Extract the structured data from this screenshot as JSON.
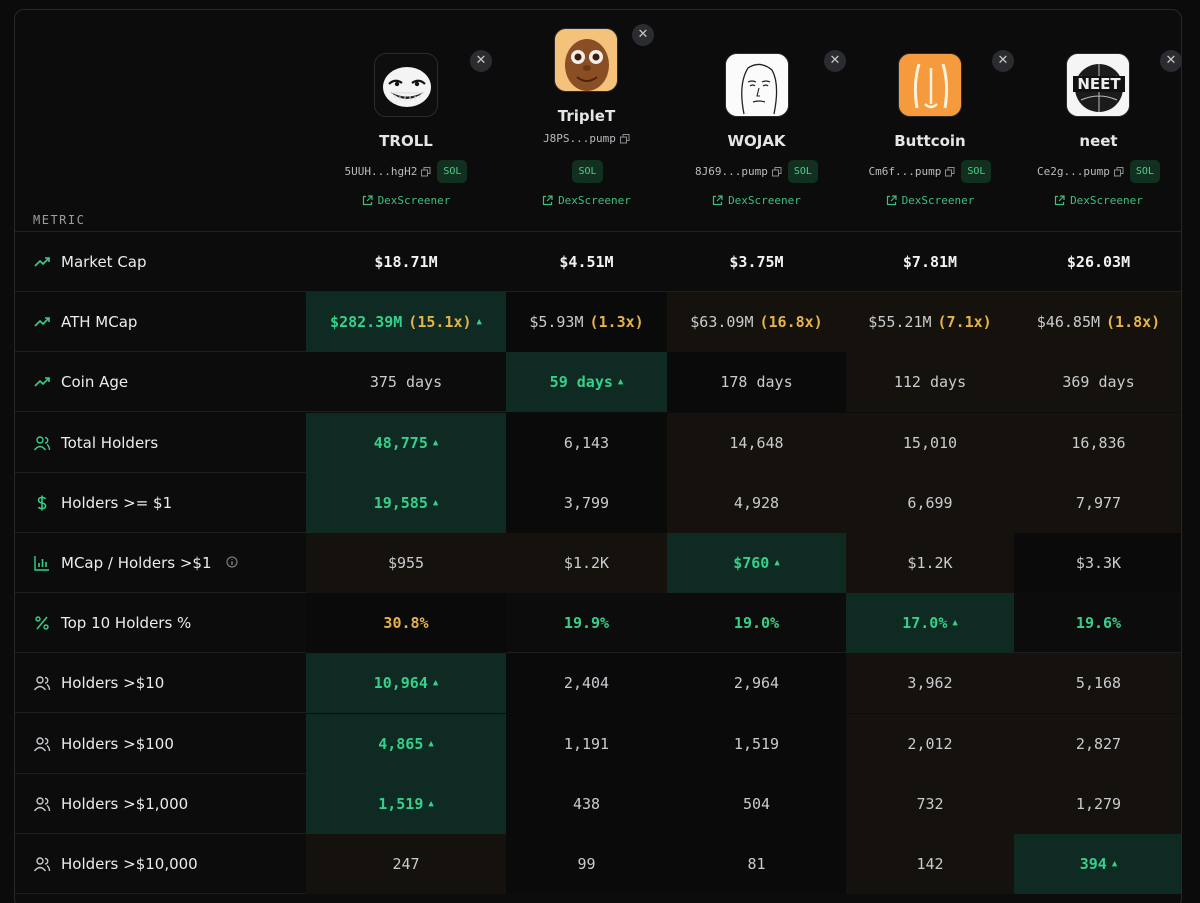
{
  "header": {
    "metric_label": "METRIC"
  },
  "coins": [
    {
      "name": "TROLL",
      "address": "5UUH...hgH2",
      "chain": "SOL",
      "link": "DexScreener",
      "icon": "troll-face-icon"
    },
    {
      "name": "TripleT",
      "address": "J8PS...pump",
      "chain": "SOL",
      "link": "DexScreener",
      "icon": "tripleT-face-icon"
    },
    {
      "name": "WOJAK",
      "address": "8J69...pump",
      "chain": "SOL",
      "link": "DexScreener",
      "icon": "wojak-face-icon"
    },
    {
      "name": "Buttcoin",
      "address": "Cm6f...pump",
      "chain": "SOL",
      "link": "DexScreener",
      "icon": "buttcoin-icon"
    },
    {
      "name": "neet",
      "address": "Ce2g...pump",
      "chain": "SOL",
      "link": "DexScreener",
      "icon": "neet-globe-icon"
    }
  ],
  "rows": [
    {
      "label": "Market Cap",
      "icon": "trend-up-icon",
      "cells": [
        {
          "v": "$18.71M"
        },
        {
          "v": "$4.51M"
        },
        {
          "v": "$3.75M"
        },
        {
          "v": "$7.81M"
        },
        {
          "v": "$26.03M"
        }
      ]
    },
    {
      "label": "ATH MCap",
      "icon": "trend-up-icon",
      "cells": [
        {
          "v": "$282.39M",
          "m": "(15.1x)"
        },
        {
          "v": "$5.93M",
          "m": "(1.3x)"
        },
        {
          "v": "$63.09M",
          "m": "(16.8x)"
        },
        {
          "v": "$55.21M",
          "m": "(7.1x)"
        },
        {
          "v": "$46.85M",
          "m": "(1.8x)"
        }
      ]
    },
    {
      "label": "Coin Age",
      "icon": "trend-up-icon",
      "cells": [
        {
          "v": "375 days"
        },
        {
          "v": "59 days"
        },
        {
          "v": "178 days"
        },
        {
          "v": "112 days"
        },
        {
          "v": "369 days"
        }
      ]
    },
    {
      "label": "Total Holders",
      "icon": "users-icon",
      "cells": [
        {
          "v": "48,775"
        },
        {
          "v": "6,143"
        },
        {
          "v": "14,648"
        },
        {
          "v": "15,010"
        },
        {
          "v": "16,836"
        }
      ]
    },
    {
      "label": "Holders >= $1",
      "icon": "dollar-icon",
      "cells": [
        {
          "v": "19,585"
        },
        {
          "v": "3,799"
        },
        {
          "v": "4,928"
        },
        {
          "v": "6,699"
        },
        {
          "v": "7,977"
        }
      ]
    },
    {
      "label": "MCap / Holders >$1",
      "icon": "bar-chart-icon",
      "cells": [
        {
          "v": "$955"
        },
        {
          "v": "$1.2K"
        },
        {
          "v": "$760"
        },
        {
          "v": "$1.2K"
        },
        {
          "v": "$3.3K"
        }
      ]
    },
    {
      "label": "Top 10 Holders %",
      "icon": "percent-icon",
      "cells": [
        {
          "v": "30.8%"
        },
        {
          "v": "19.9%"
        },
        {
          "v": "19.0%"
        },
        {
          "v": "17.0%"
        },
        {
          "v": "19.6%"
        }
      ]
    },
    {
      "label": "Holders >$10",
      "icon": "users-outline-icon",
      "cells": [
        {
          "v": "10,964"
        },
        {
          "v": "2,404"
        },
        {
          "v": "2,964"
        },
        {
          "v": "3,962"
        },
        {
          "v": "5,168"
        }
      ]
    },
    {
      "label": "Holders >$100",
      "icon": "users-outline-icon",
      "cells": [
        {
          "v": "4,865"
        },
        {
          "v": "1,191"
        },
        {
          "v": "1,519"
        },
        {
          "v": "2,012"
        },
        {
          "v": "2,827"
        }
      ]
    },
    {
      "label": "Holders >$1,000",
      "icon": "users-outline-icon",
      "cells": [
        {
          "v": "1,519"
        },
        {
          "v": "438"
        },
        {
          "v": "504"
        },
        {
          "v": "732"
        },
        {
          "v": "1,279"
        }
      ]
    },
    {
      "label": "Holders >$10,000",
      "icon": "users-outline-icon",
      "cells": [
        {
          "v": "247"
        },
        {
          "v": "99"
        },
        {
          "v": "81"
        },
        {
          "v": "142"
        },
        {
          "v": "394"
        }
      ]
    }
  ],
  "colors": {
    "positive": "#36d08a",
    "warning": "#e6b34a",
    "highlight_bg": "#0e2a22"
  }
}
